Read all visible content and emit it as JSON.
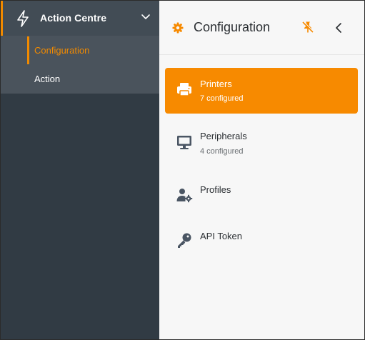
{
  "sidebar": {
    "section_title": "Action Centre",
    "items": [
      {
        "label": "Configuration",
        "active": true
      },
      {
        "label": "Action",
        "active": false
      }
    ]
  },
  "panel": {
    "title": "Configuration",
    "items": [
      {
        "name": "Printers",
        "count": "7 configured",
        "active": true,
        "icon": "printer-icon"
      },
      {
        "name": "Peripherals",
        "count": "4 configured",
        "active": false,
        "icon": "monitor-icon"
      },
      {
        "name": "Profiles",
        "count": "",
        "active": false,
        "icon": "users-gear-icon"
      },
      {
        "name": "API Token",
        "count": "",
        "active": false,
        "icon": "key-icon"
      }
    ]
  },
  "colors": {
    "accent": "#f78a00",
    "sidebar_bg": "#313b44",
    "sidebar_header_bg": "#424c55",
    "submenu_bg": "#4a535c",
    "panel_bg": "#f7f7f7",
    "icon_slate": "#4a5563"
  }
}
